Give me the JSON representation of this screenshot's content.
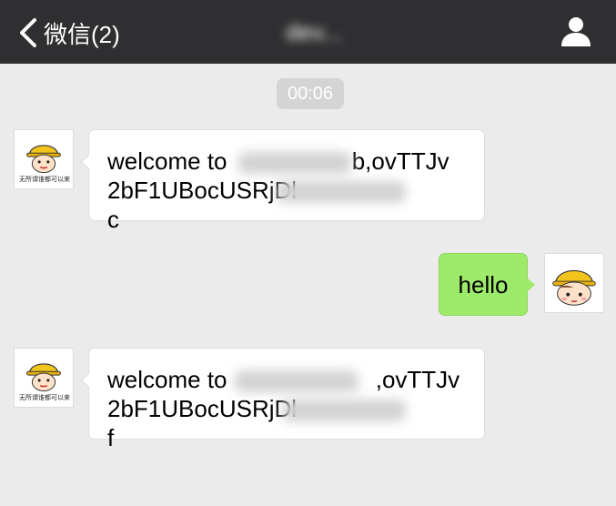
{
  "navbar": {
    "back_label": "微信(2)",
    "title": "dev..."
  },
  "timestamp": "00:06",
  "messages": [
    {
      "direction": "incoming",
      "text": "welcome to      b,ovTTJv\n2bF1UBocUSRjDl        c",
      "avatar_caption": "无所谓谁都可以来"
    },
    {
      "direction": "outgoing",
      "text": "hello"
    },
    {
      "direction": "incoming",
      "text": "welcome to       ,ovTTJv\n2bF1UBocUSRjDl        f",
      "avatar_caption": "无所谓谁都可以来"
    }
  ],
  "icons": {
    "back": "chevron-left-icon",
    "contact": "person-icon"
  },
  "colors": {
    "navbar": "#2f2f31",
    "background": "#ebebeb",
    "outgoing_bubble": "#9eea6a"
  }
}
